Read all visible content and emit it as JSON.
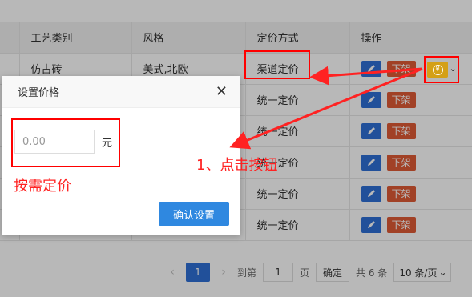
{
  "table": {
    "headers": [
      "工艺类别",
      "风格",
      "定价方式",
      "操作"
    ],
    "rows": [
      {
        "craft": "仿古砖",
        "style": "美式,北欧",
        "pricing": "渠道定价"
      },
      {
        "craft": "",
        "style": "",
        "pricing": "统一定价"
      },
      {
        "craft": "",
        "style": "",
        "pricing": "统一定价"
      },
      {
        "craft": "",
        "style": "",
        "pricing": "统一定价"
      },
      {
        "craft": "",
        "style": "",
        "pricing": "统一定价"
      },
      {
        "craft": "",
        "style": "",
        "pricing": "统一定价"
      }
    ],
    "actions": {
      "edit_icon": "pencil-icon",
      "off_label": "下架",
      "price_icon": "yen-coin-icon"
    }
  },
  "pagination": {
    "prev": "‹",
    "current_page": "1",
    "next": "›",
    "goto_label": "到第",
    "goto_value": "1",
    "page_label": "页",
    "confirm_label": "确定",
    "total_label": "共 6 条",
    "page_size_label": "10 条/页"
  },
  "modal": {
    "title": "设置价格",
    "close": "✕",
    "input_placeholder": "0.00",
    "unit": "元",
    "confirm_label": "确认设置"
  },
  "annotations": {
    "click_hint": "1、点击按钮",
    "price_hint": "按需定价",
    "color": "#ff2020"
  }
}
